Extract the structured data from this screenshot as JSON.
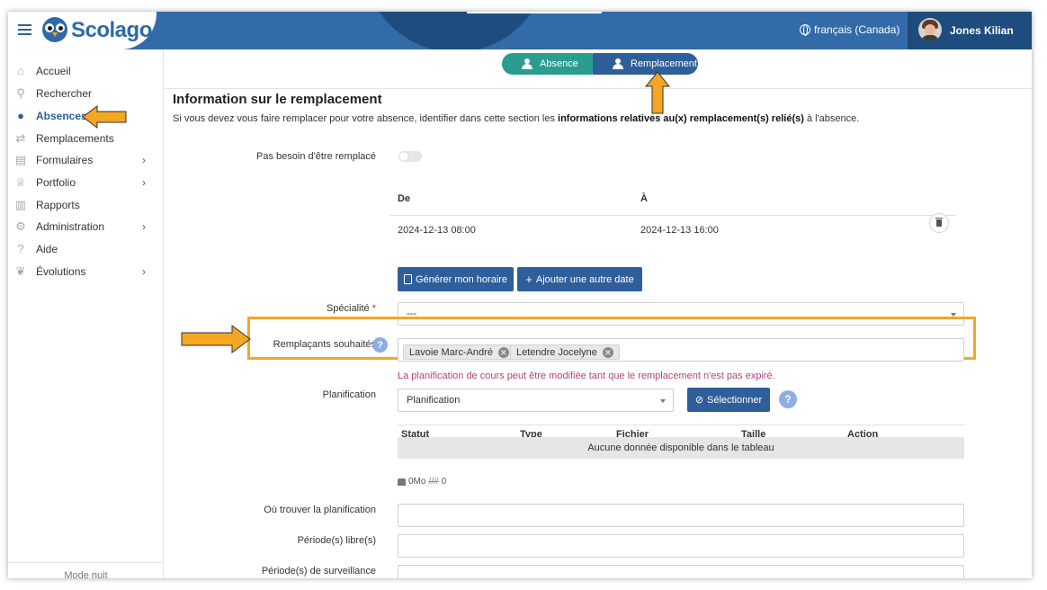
{
  "header": {
    "brand": "Scolago",
    "language": "français (Canada)",
    "user_name": "Jones Kilian"
  },
  "sidebar": {
    "items": [
      {
        "label": "Accueil",
        "icon": "home-icon",
        "chevron": ""
      },
      {
        "label": "Rechercher",
        "icon": "search-icon",
        "chevron": ""
      },
      {
        "label": "Absences",
        "icon": "user-clock-icon",
        "chevron": "",
        "active": true
      },
      {
        "label": "Remplacements",
        "icon": "swap-icon",
        "chevron": ""
      },
      {
        "label": "Formulaires",
        "icon": "form-icon",
        "chevron": "›"
      },
      {
        "label": "Portfolio",
        "icon": "trophy-icon",
        "chevron": "›"
      },
      {
        "label": "Rapports",
        "icon": "report-icon",
        "chevron": ""
      },
      {
        "label": "Administration",
        "icon": "gear-icon",
        "chevron": "›"
      },
      {
        "label": "Aide",
        "icon": "question-icon",
        "chevron": ""
      },
      {
        "label": "Évolutions",
        "icon": "sprout-icon",
        "chevron": "›"
      }
    ],
    "footer": "Mode nuit"
  },
  "steps": {
    "absence": "Absence",
    "remplacement": "Remplacement"
  },
  "section": {
    "title": "Information sur le remplacement",
    "intro_start": "Si vous devez vous faire remplacer pour votre absence, identifier dans cette section les ",
    "intro_bold": "informations relatives au(x) remplacement(s) relié(s)",
    "intro_end": " à l'absence."
  },
  "form": {
    "no_replacement_label": "Pas besoin d'être remplacé",
    "dates_table": {
      "col_from": "De",
      "col_to": "À",
      "rows": [
        {
          "from": "2024-12-13 08:00",
          "to": "2024-12-13 16:00"
        }
      ]
    },
    "btn_generate": "Générer mon horaire",
    "btn_add_date": "Ajouter une autre date",
    "specialty_label": "Spécialité",
    "specialty_required": "*",
    "specialty_value": "---",
    "wished_label": "Remplaçants souhaités",
    "wished_tags": [
      "Lavoie Marc-André",
      "Letendre Jocelyne"
    ],
    "planning_note": "La planification de cours peut être modifiée tant que le remplacement n'est pas expiré.",
    "planning_label": "Planification",
    "planning_value": "Planification",
    "btn_select": "Sélectionner",
    "files_table": {
      "columns": [
        "Statut",
        "Type",
        "Fichier",
        "Taille",
        "Action"
      ],
      "empty": "Aucune donnée disponible dans le tableau"
    },
    "quota_size": "0Mo",
    "quota_count": "0",
    "where_label": "Où trouver la planification",
    "free_periods_label": "Période(s) libre(s)",
    "supervision_label": "Période(s) de surveillance"
  },
  "help_mark": "?",
  "colors": {
    "primary": "#2f5f9a",
    "teal": "#2a9d8f",
    "highlight": "#f5a623"
  }
}
